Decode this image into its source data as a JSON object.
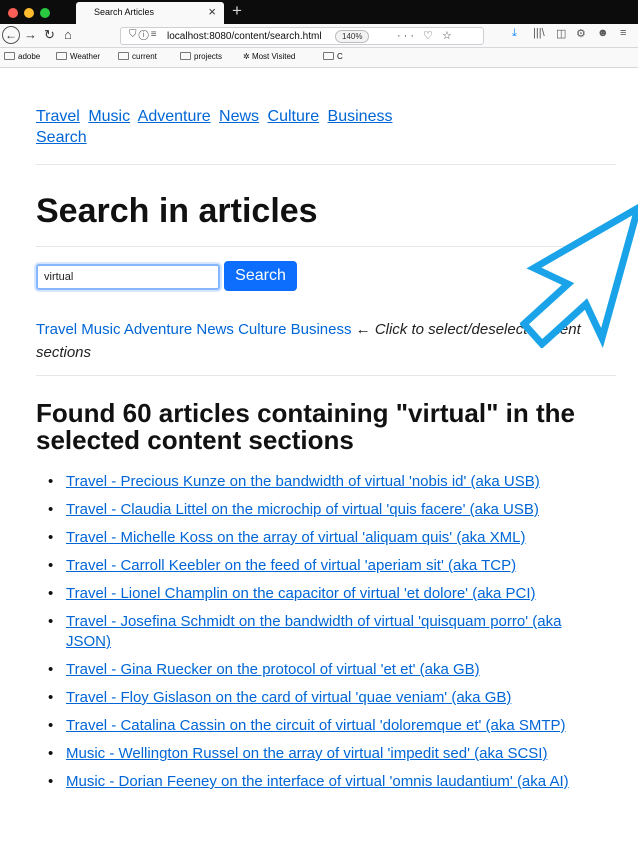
{
  "browser": {
    "tab_title": "Search Articles",
    "tab_close": "×",
    "new_tab": "+",
    "url": "localhost:8080/content/search.html",
    "zoom": "140%",
    "bookmarks": [
      "adobe",
      "Weather",
      "current",
      "projects",
      "Most Visited",
      "C"
    ]
  },
  "nav": {
    "items": [
      "Travel",
      "Music",
      "Adventure",
      "News",
      "Culture",
      "Business",
      "Search"
    ]
  },
  "page": {
    "title": "Search in articles",
    "search_value": "virtual",
    "search_button": "Search",
    "sections": [
      "Travel",
      "Music",
      "Adventure",
      "News",
      "Culture",
      "Business"
    ],
    "sections_hint": "Click to select/deselect content sections",
    "arrow": "←",
    "results_heading": "Found 60 articles containing \"virtual\" in the selected content sections"
  },
  "results": [
    "Travel - Precious Kunze on the bandwidth of virtual 'nobis id' (aka USB)",
    "Travel - Claudia Littel on the microchip of virtual 'quis facere' (aka USB)",
    "Travel - Michelle Koss on the array of virtual 'aliquam quis' (aka XML)",
    "Travel - Carroll Keebler on the feed of virtual 'aperiam sit' (aka TCP)",
    "Travel - Lionel Champlin on the capacitor of virtual 'et dolore' (aka PCI)",
    "Travel - Josefina Schmidt on the bandwidth of virtual 'quisquam porro' (aka JSON)",
    "Travel - Gina Ruecker on the protocol of virtual 'et et' (aka GB)",
    "Travel - Floy Gislason on the card of virtual 'quae veniam' (aka GB)",
    "Travel - Catalina Cassin on the circuit of virtual 'doloremque et' (aka SMTP)",
    "Music - Wellington Russel on the array of virtual 'impedit sed' (aka SCSI)",
    "Music - Dorian Feeney on the interface of virtual 'omnis laudantium' (aka AI)"
  ],
  "colors": {
    "link": "#0066d6",
    "button": "#0d6efd",
    "cursor_outline": "#1aa3e8"
  }
}
